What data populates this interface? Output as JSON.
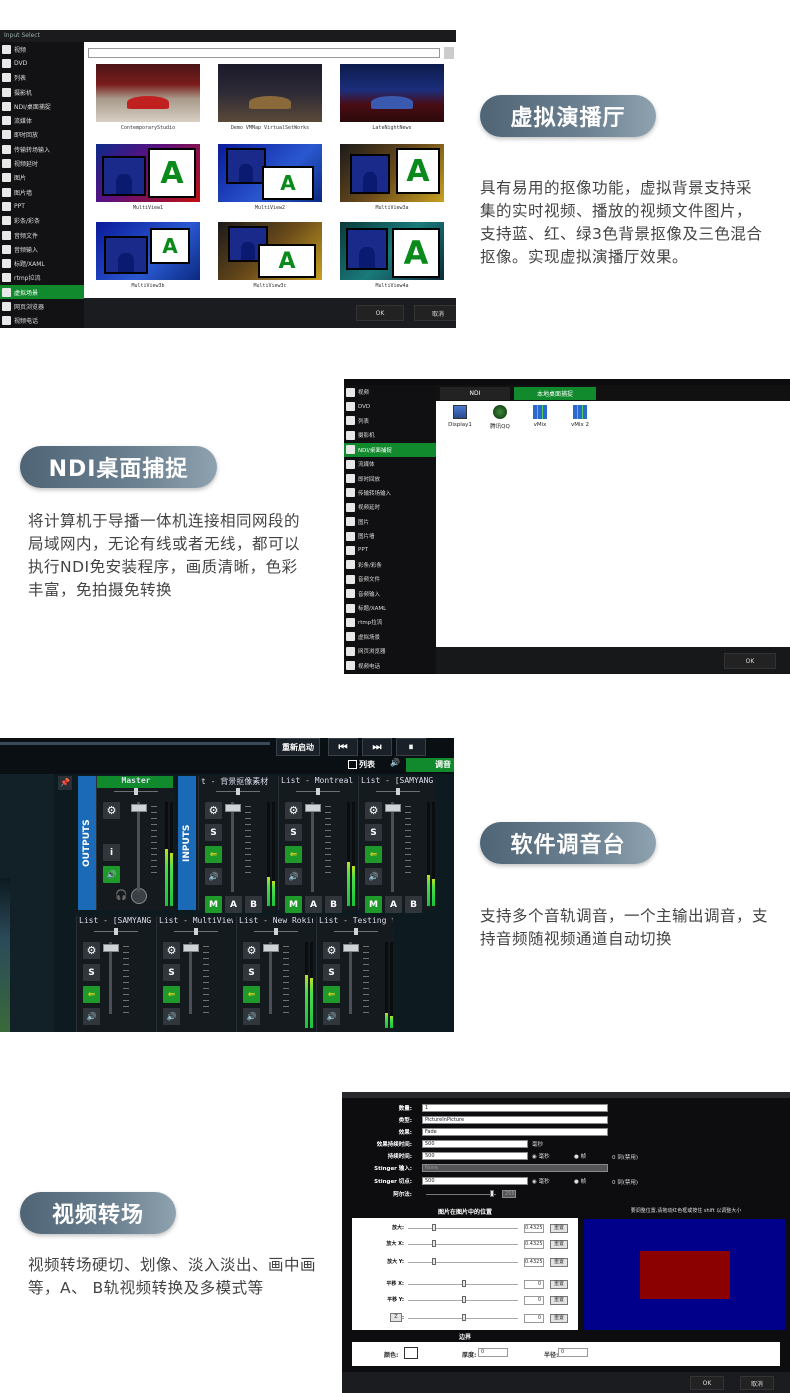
{
  "sections": [
    {
      "title": "虚拟演播厅",
      "description": "具有易用的抠像功能，虚拟背景支持采集的实时视频、播放的视频文件图片，支持蓝、红、绿3色背景抠像及三色混合抠像。实现虚拟演播厅效果。"
    },
    {
      "title": "NDI桌面捕捉",
      "description": "将计算机于导播一体机连接相同网段的局域网内，无论有线或者无线，都可以执行NDI免安装程序，画质清晰，色彩丰富，免拍摄免转换"
    },
    {
      "title": "软件调音台",
      "description": "支持多个音轨调音，一个主输出调音，支持音频随视频通道自动切换"
    },
    {
      "title": "视频转场",
      "description": "视频转场硬切、划像、淡入淡出、画中画等，A、 B轨视频转换及多模式等"
    }
  ],
  "shot1": {
    "window_title": "Input Select",
    "sidebar": [
      "视频",
      "DVD",
      "列表",
      "摄影机",
      "NDI/桌面捕捉",
      "流媒体",
      "即时回放",
      "传输转场输入",
      "视频延时",
      "图片",
      "图片墙",
      "PPT",
      "彩条/彩条",
      "音频文件",
      "音频输入",
      "标题/XAML",
      "rtmp拉流",
      "虚拟场景",
      "网页浏览器",
      "视频电话"
    ],
    "active_index": 17,
    "thumbs": [
      "ContemporaryStudio",
      "Demo VMMap VirtualSetWorks",
      "LateNightNews",
      "MultiView1",
      "MultiView2",
      "MultiView3a",
      "MultiView3b",
      "MultiView3c",
      "MultiView4a"
    ],
    "ok": "OK",
    "cancel": "取消"
  },
  "shot2": {
    "sidebar": [
      "视频",
      "DVD",
      "列表",
      "摄影机",
      "NDI/桌面捕捉",
      "流媒体",
      "即时回放",
      "传输转场输入",
      "视频延时",
      "图片",
      "图片墙",
      "PPT",
      "彩条/彩条",
      "音频文件",
      "音频输入",
      "标题/XAML",
      "rtmp拉流",
      "虚拟场景",
      "网页浏览器",
      "视频电话"
    ],
    "active_index": 4,
    "tabs": [
      "NDI",
      "本地桌面捕捉"
    ],
    "sources": [
      "Display1",
      "腾讯QQ",
      "vMix",
      "vMix 2"
    ],
    "ok": "OK"
  },
  "shot3": {
    "top_buttons": [
      "重新启动",
      "⏮",
      "⏭",
      "⏸"
    ],
    "list_label": "列表",
    "tune_label": "调音",
    "outputs_label": "OUTPUTS",
    "inputs_label": "INPUTS",
    "strips_row1": [
      "Master",
      "t - 背景抠像素材",
      "List - Montreal",
      "List - [SAMYANG"
    ],
    "strips_row2": [
      "List - [SAMYANG",
      "List - MultiView",
      "List - New Rokin",
      "List - Testing t"
    ],
    "btn_s": "S",
    "btn_i": "i",
    "btn_m": "M",
    "btn_a": "A",
    "btn_b": "B"
  },
  "shot4": {
    "fields": [
      {
        "label": "数量:",
        "value": "1"
      },
      {
        "label": "类型:",
        "value": "PictureInPicture"
      },
      {
        "label": "效果:",
        "value": "Fade"
      },
      {
        "label": "效果持续时间:",
        "value": "500"
      },
      {
        "label": "持续时间:",
        "value": "500"
      },
      {
        "label": "Stinger 输入:",
        "value": "None"
      },
      {
        "label": "Stinger 切点:",
        "value": "500"
      },
      {
        "label": "阿尔法:",
        "value": "255"
      }
    ],
    "unit_ms": "毫秒",
    "radio_ms": "毫秒",
    "radio_frame": "帧",
    "disabled": "0 到(禁用)",
    "panel_title": "图片在图片中的位置",
    "preview_title": "要调整位置,请拖动红色框或按住 shift 以调整大小",
    "rows": [
      {
        "label": "放大:",
        "value": "0.4325"
      },
      {
        "label": "放大 X:",
        "value": "0.4325"
      },
      {
        "label": "放大 Y:",
        "value": "0.4325"
      },
      {
        "label": "平移 X:",
        "value": "0"
      },
      {
        "label": "平移 Y:",
        "value": "0"
      },
      {
        "label": "旋转:",
        "value": "0"
      }
    ],
    "reset": "重置",
    "z_btn": "Z",
    "border_title": "边界",
    "color_label": "颜色:",
    "thickness_label": "厚度:",
    "thickness_value": "0",
    "radius_label": "半径:",
    "radius_value": "0",
    "ok": "OK",
    "cancel": "取消",
    "colors": {
      "preview_bg": "#00008b",
      "preview_box": "#8b0000"
    }
  }
}
